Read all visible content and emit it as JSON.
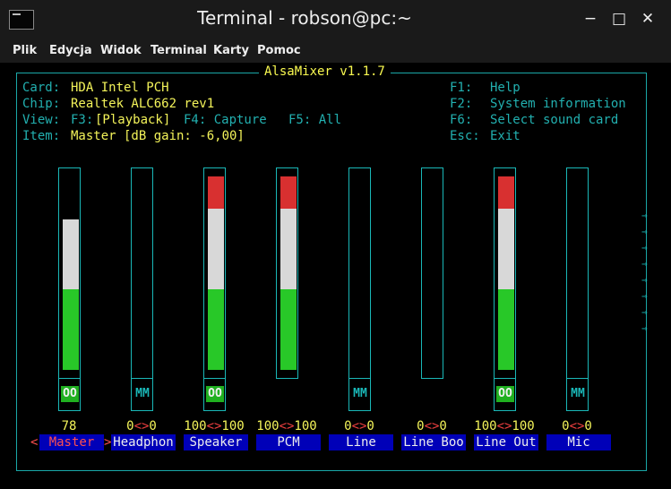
{
  "window": {
    "title": "Terminal - robson@pc:~",
    "minimize_glyph": "−",
    "maximize_glyph": "□",
    "close_glyph": "✕"
  },
  "menu": [
    "Plik",
    "Edycja",
    "Widok",
    "Terminal",
    "Karty",
    "Pomoc"
  ],
  "alsamixer": {
    "title": "AlsaMixer v1.1.7",
    "info": {
      "card_label": "Card:",
      "card_value": "HDA Intel PCH",
      "chip_label": "Chip:",
      "chip_value": "Realtek ALC662 rev1",
      "view_label": "View:",
      "view_f3": "F3:",
      "view_playback": "[Playback]",
      "view_f4": "F4: Capture",
      "view_f5": "F5: All",
      "item_label": "Item:",
      "item_value": "Master [dB gain: -6,00]"
    },
    "help": [
      {
        "key": "F1:",
        "text": "Help"
      },
      {
        "key": "F2:",
        "text": "System information"
      },
      {
        "key": "F6:",
        "text": "Select sound card"
      },
      {
        "key": "Esc:",
        "text": "Exit"
      }
    ],
    "selected_left": "<",
    "selected_right": ">",
    "channels": [
      {
        "name": "Master",
        "volume_text": [
          "78"
        ],
        "mute": "OO",
        "level": 0.78,
        "selected": true
      },
      {
        "name": "Headphon",
        "volume_text": [
          "0",
          "<>",
          "0"
        ],
        "mute": "MM",
        "level": 0,
        "selected": false
      },
      {
        "name": "Speaker",
        "volume_text": [
          "100",
          "<>",
          "100"
        ],
        "mute": "OO",
        "level": 1.0,
        "selected": false
      },
      {
        "name": "PCM",
        "volume_text": [
          "100",
          "<>",
          "100"
        ],
        "mute": "",
        "level": 1.0,
        "selected": false
      },
      {
        "name": "Line",
        "volume_text": [
          "0",
          "<>",
          "0"
        ],
        "mute": "MM",
        "level": 0,
        "selected": false
      },
      {
        "name": "Line Boo",
        "volume_text": [
          "0",
          "<>",
          "0"
        ],
        "mute": "",
        "level": 0,
        "selected": false
      },
      {
        "name": "Line Out",
        "volume_text": [
          "100",
          "<>",
          "100"
        ],
        "mute": "OO",
        "level": 1.0,
        "selected": false
      },
      {
        "name": "Mic",
        "volume_text": [
          "0",
          "<>",
          "0"
        ],
        "mute": "MM",
        "level": 0,
        "selected": false
      }
    ],
    "scroll_arrow": "→",
    "colors": {
      "green": "#28c828",
      "white": "#d8d8d8",
      "red": "#d83030",
      "frame": "#1ab8b8"
    }
  }
}
